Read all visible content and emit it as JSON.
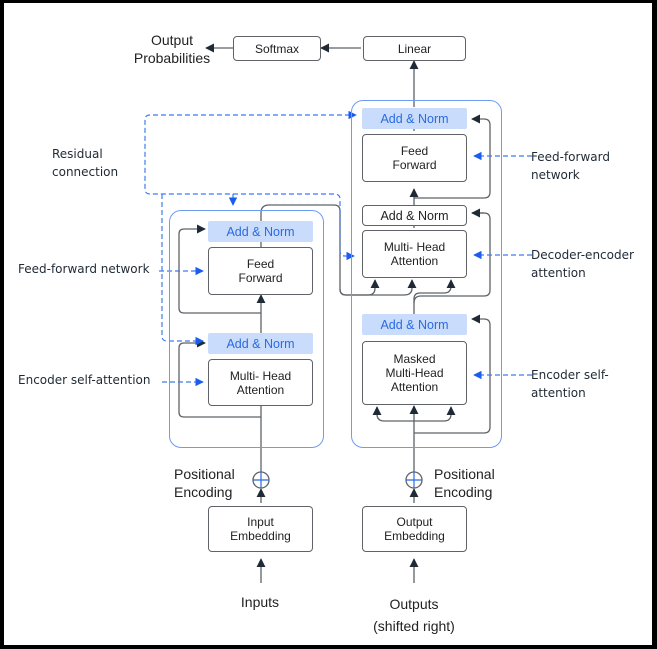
{
  "output": {
    "probabilities_label": "Output\nProbabilities",
    "softmax": "Softmax",
    "linear": "Linear"
  },
  "encoder": {
    "add_norm_top": "Add & Norm",
    "feed_forward": "Feed\nForward",
    "add_norm_bottom": "Add & Norm",
    "attention": "Multi- Head\nAttention",
    "positional_encoding": "Positional\nEncoding",
    "embedding": "Input\nEmbedding",
    "inputs": "Inputs"
  },
  "decoder": {
    "add_norm_top": "Add & Norm",
    "feed_forward": "Feed\nForward",
    "add_norm_middle": "Add & Norm",
    "cross_attention": "Multi- Head\nAttention",
    "add_norm_bottom": "Add & Norm",
    "masked_attention": "Masked\nMulti-Head\nAttention",
    "positional_encoding": "Positional\nEncoding",
    "embedding": "Output\nEmbedding",
    "outputs": "Outputs\n(shifted right)"
  },
  "annotations": {
    "residual": "Residual\nconnection",
    "enc_ffn": "Feed-forward network",
    "enc_self_attention": "Encoder self-attention",
    "dec_ffn": "Feed-forward\nnetwork",
    "dec_enc_attention": "Decoder-encoder\nattention",
    "dec_self_attention": "Encoder self-\nattention"
  },
  "colors": {
    "accent": "#2b6ae0",
    "add_norm_fill": "#c9dcfb",
    "container_border": "#6d9cf0",
    "line": "#5f6368"
  }
}
